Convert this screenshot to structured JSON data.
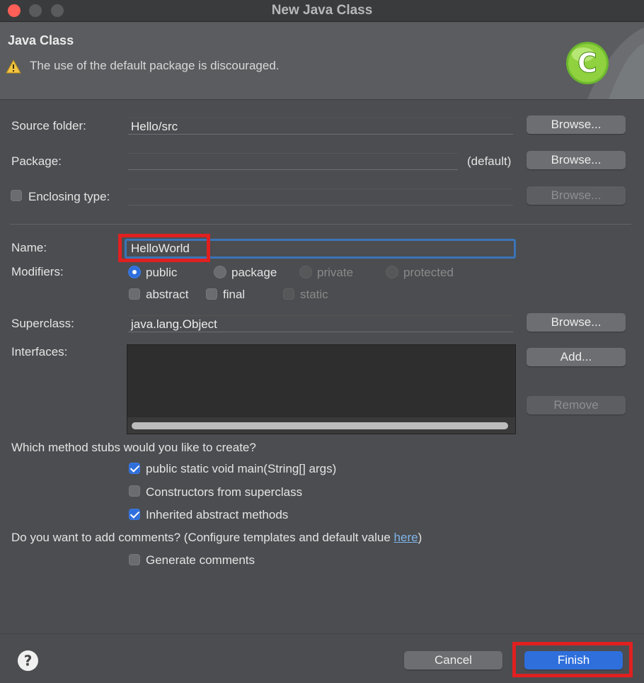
{
  "window": {
    "title": "New Java Class",
    "colors": {
      "close": "#fe5f57",
      "minimize": "#5a5b5d",
      "zoom": "#5a5b5d"
    }
  },
  "header": {
    "title": "Java Class",
    "message": "The use of the default package is discouraged.",
    "warning_icon": "warning-triangle-icon",
    "logo_icon": "java-class-c-icon"
  },
  "source_folder": {
    "label": "Source folder:",
    "value": "Hello/src",
    "browse": "Browse..."
  },
  "package": {
    "label": "Package:",
    "value": "",
    "suffix": "(default)",
    "browse": "Browse..."
  },
  "enclosing_type": {
    "label": "Enclosing type:",
    "checked": false,
    "value": "",
    "browse": "Browse..."
  },
  "name": {
    "label": "Name:",
    "value": "HelloWorld"
  },
  "modifiers": {
    "label": "Modifiers:",
    "access": [
      "public",
      "package",
      "private",
      "protected"
    ],
    "selected": "public",
    "flags": [
      "abstract",
      "final",
      "static"
    ]
  },
  "superclass": {
    "label": "Superclass:",
    "value": "java.lang.Object",
    "browse": "Browse..."
  },
  "interfaces": {
    "label": "Interfaces:",
    "add": "Add...",
    "remove": "Remove"
  },
  "stubs": {
    "question": "Which method stubs would you like to create?",
    "items": [
      {
        "label": "public static void main(String[] args)",
        "checked": true
      },
      {
        "label": "Constructors from superclass",
        "checked": false
      },
      {
        "label": "Inherited abstract methods",
        "checked": true
      }
    ]
  },
  "comments": {
    "question_prefix": "Do you want to add comments? (Configure templates and default value ",
    "link": "here",
    "question_suffix": ")",
    "generate": "Generate comments",
    "checked": false
  },
  "footer": {
    "help_icon": "help-icon",
    "cancel": "Cancel",
    "finish": "Finish",
    "accent": "#2f6fdc"
  }
}
